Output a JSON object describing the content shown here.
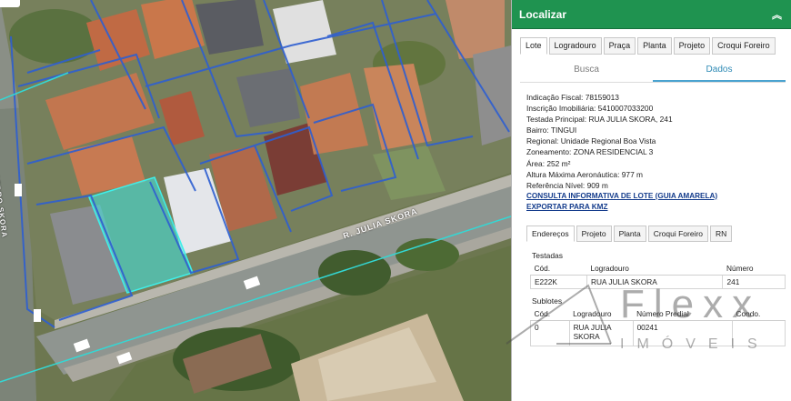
{
  "map": {
    "street_main": "R. JULIA SKORA",
    "street_side": "R. PEDRO SKORA"
  },
  "panel": {
    "title": "Localizar",
    "collapse_icon": "double-chevron-up-icon",
    "tabs": [
      "Lote",
      "Logradouro",
      "Praça",
      "Planta",
      "Projeto",
      "Croqui Foreiro"
    ],
    "active_tab": "Lote",
    "subtabs": [
      "Busca",
      "Dados"
    ],
    "active_subtab": "Dados",
    "info": {
      "indicacao_fiscal": {
        "label": "Indicação Fiscal:",
        "value": "78159013"
      },
      "inscricao": {
        "label": "Inscrição Imobiliária:",
        "value": "5410007033200"
      },
      "testada": {
        "label": "Testada Principal:",
        "value": "RUA JULIA SKORA, 241"
      },
      "bairro": {
        "label": "Bairro:",
        "value": "TINGUI"
      },
      "regional": {
        "label": "Regional:",
        "value": "Unidade Regional Boa Vista"
      },
      "zoneamento": {
        "label": "Zoneamento:",
        "value": "ZONA RESIDENCIAL 3"
      },
      "area": {
        "label": "Área:",
        "value": "252 m²"
      },
      "altura": {
        "label": "Altura Máxima Aeronáutica:",
        "value": "977 m"
      },
      "referencia": {
        "label": "Referência Nível:",
        "value": "909 m"
      }
    },
    "link_consulta": "CONSULTA INFORMATIVA DE LOTE (GUIA AMARELA)",
    "link_kmz": "EXPORTAR PARA KMZ",
    "detail_tabs": [
      "Endereços",
      "Projeto",
      "Planta",
      "Croqui Foreiro",
      "RN"
    ],
    "active_detail_tab": "Endereços",
    "testadas": {
      "title": "Testadas",
      "columns": [
        "Cód.",
        "Logradouro",
        "Número"
      ],
      "rows": [
        [
          "E222K",
          "RUA JULIA SKORA",
          "241"
        ]
      ]
    },
    "sublotes": {
      "title": "Sublotes",
      "columns": [
        "Cód.",
        "Logradouro",
        "Número Predial",
        "Condo."
      ],
      "rows": [
        [
          "0",
          "RUA JULIA SKORA",
          "00241",
          ""
        ]
      ]
    }
  },
  "watermark": {
    "brand": "Flexx",
    "tagline": "IMÓVEIS"
  }
}
